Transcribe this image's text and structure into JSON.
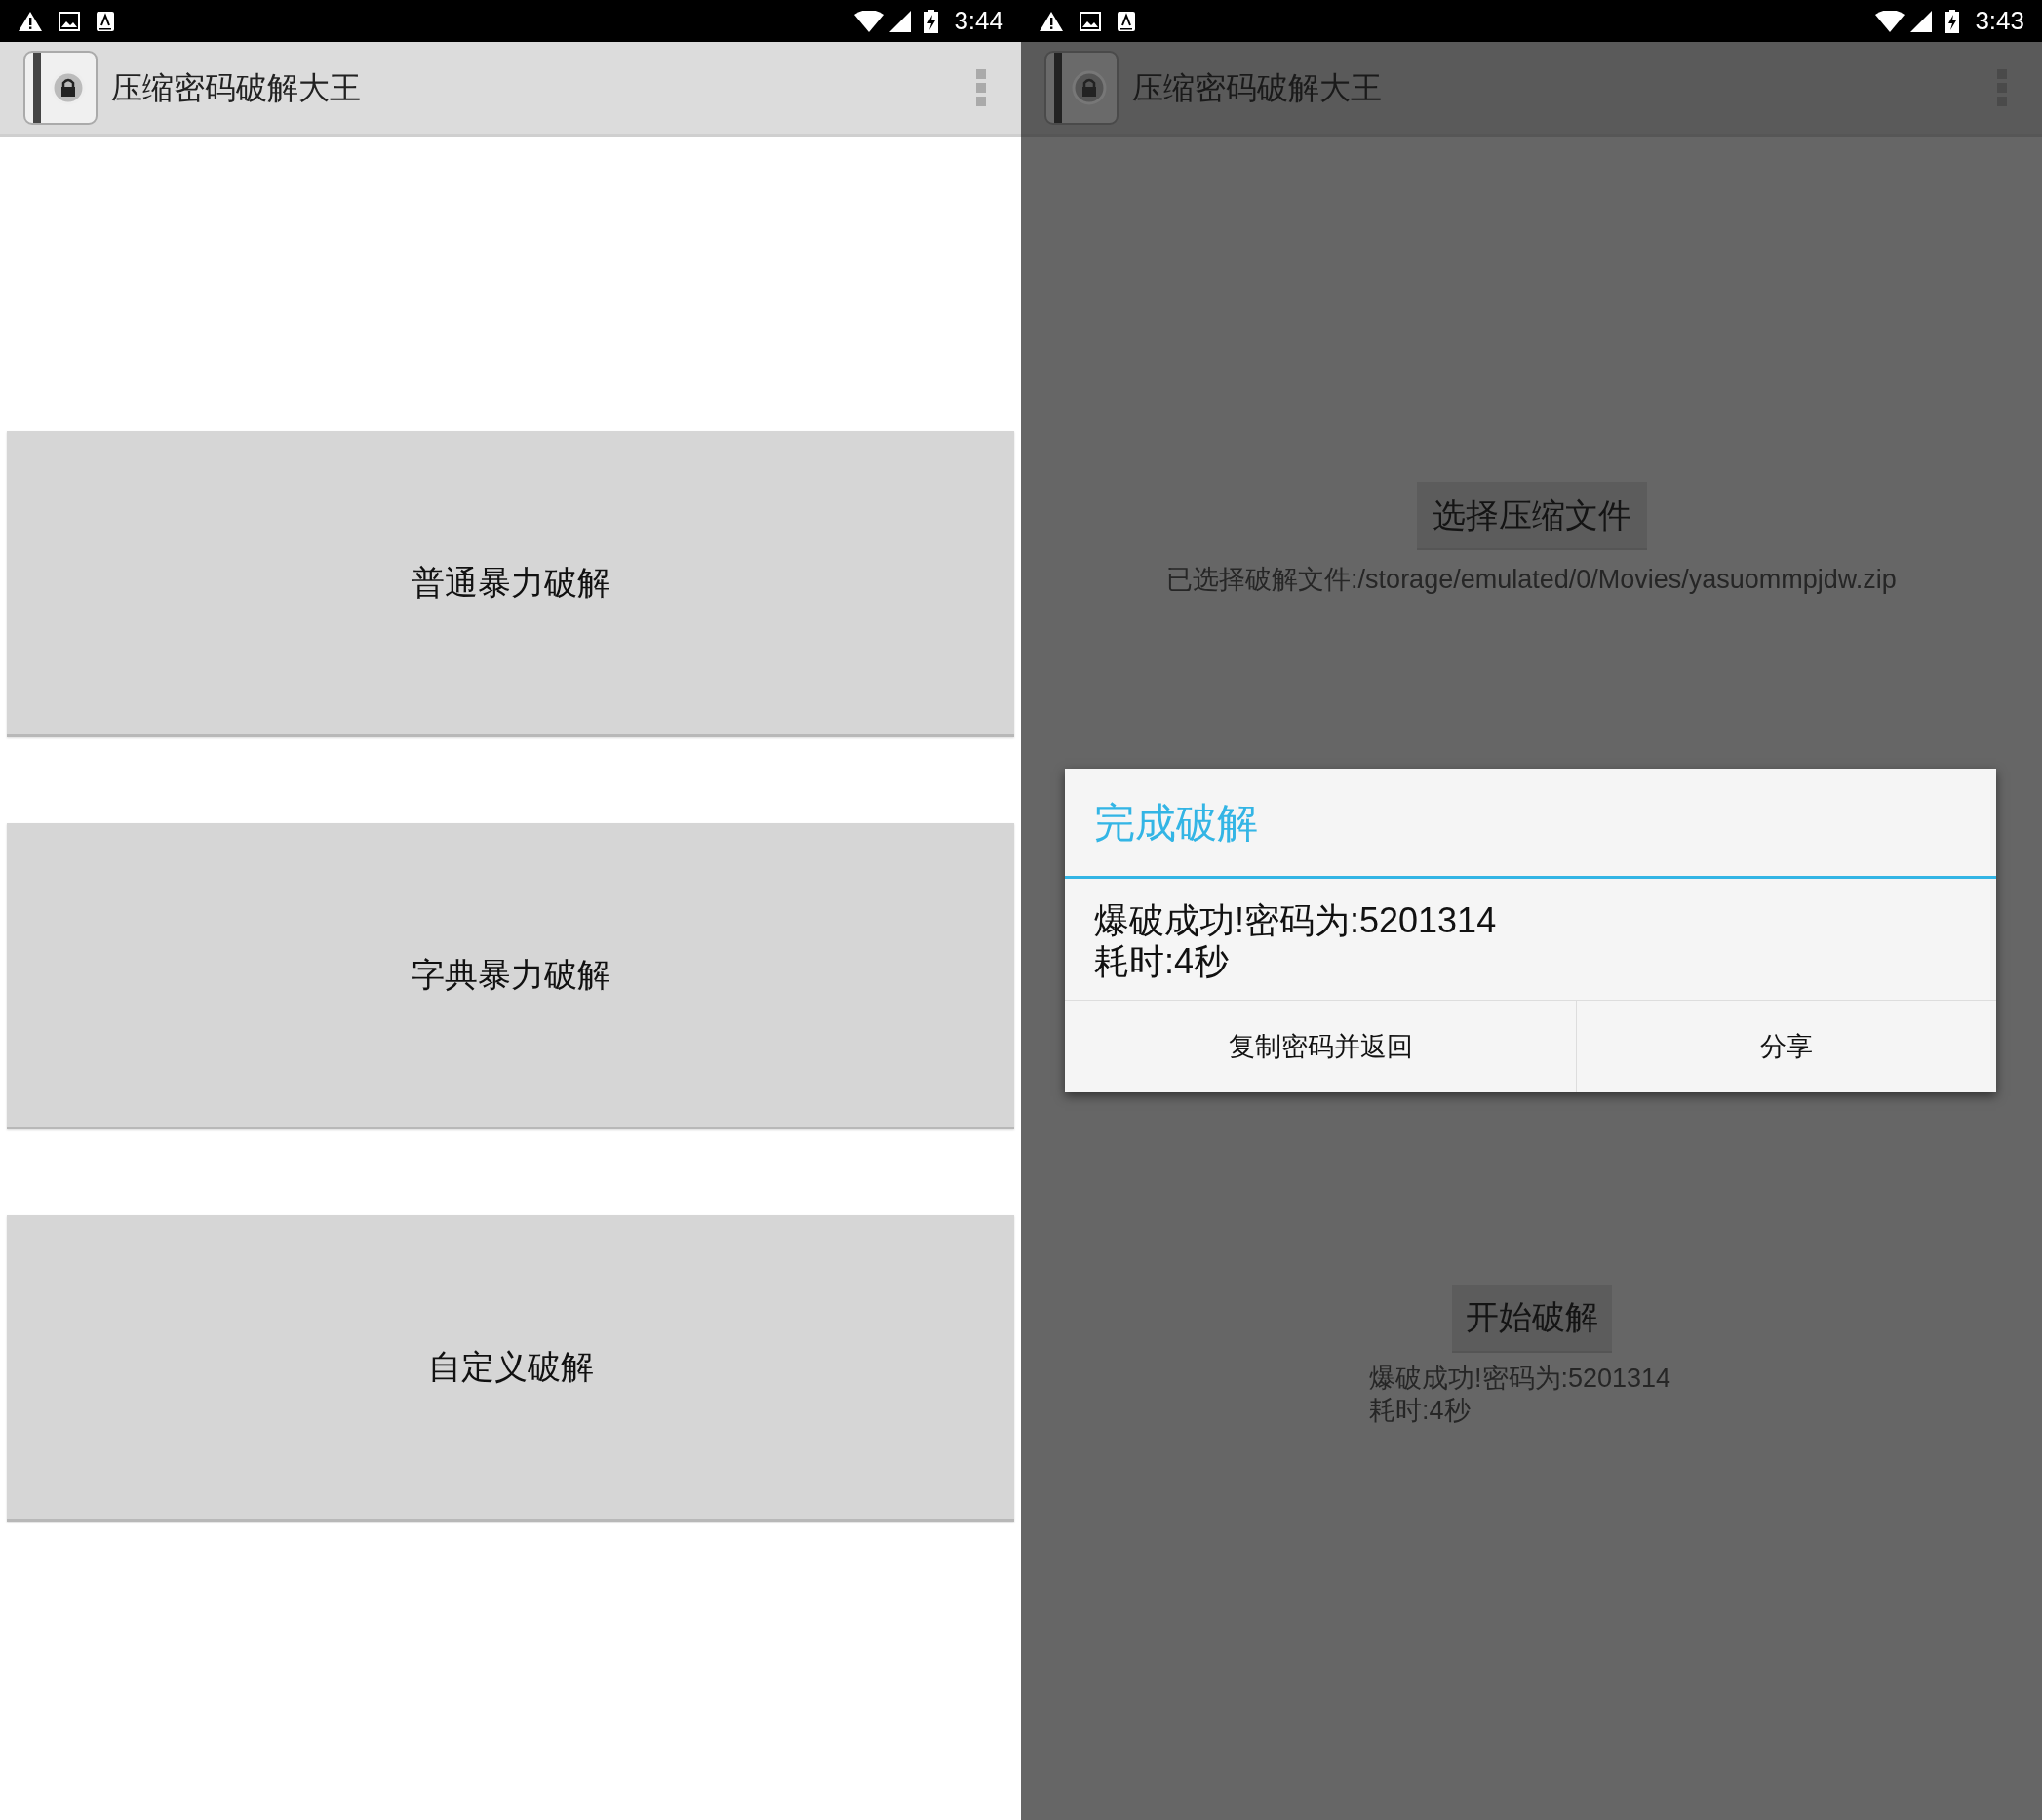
{
  "screens": [
    {
      "dimmed": false,
      "status_bar": {
        "time": "3:44"
      },
      "app_bar": {
        "title": "压缩密码破解大王"
      },
      "content": {
        "kind": "menu",
        "buttons": [
          "普通暴力破解",
          "字典暴力破解",
          "自定义破解"
        ]
      }
    },
    {
      "dimmed": true,
      "status_bar": {
        "time": "3:43"
      },
      "app_bar": {
        "title": "压缩密码破解大王"
      },
      "content": {
        "kind": "crack",
        "choose_button": "选择压缩文件",
        "selected_file": "已选择破解文件:/storage/emulated/0/Movies/yasuommpjdw.zip",
        "start_button": "开始破解",
        "result_lines": [
          "爆破成功!密码为:5201314",
          "耗时:4秒"
        ]
      },
      "dialog": {
        "title": "完成破解",
        "message_lines": [
          "爆破成功!密码为:5201314",
          "耗时:4秒"
        ],
        "buttons": [
          "复制密码并返回",
          "分享"
        ]
      }
    }
  ]
}
